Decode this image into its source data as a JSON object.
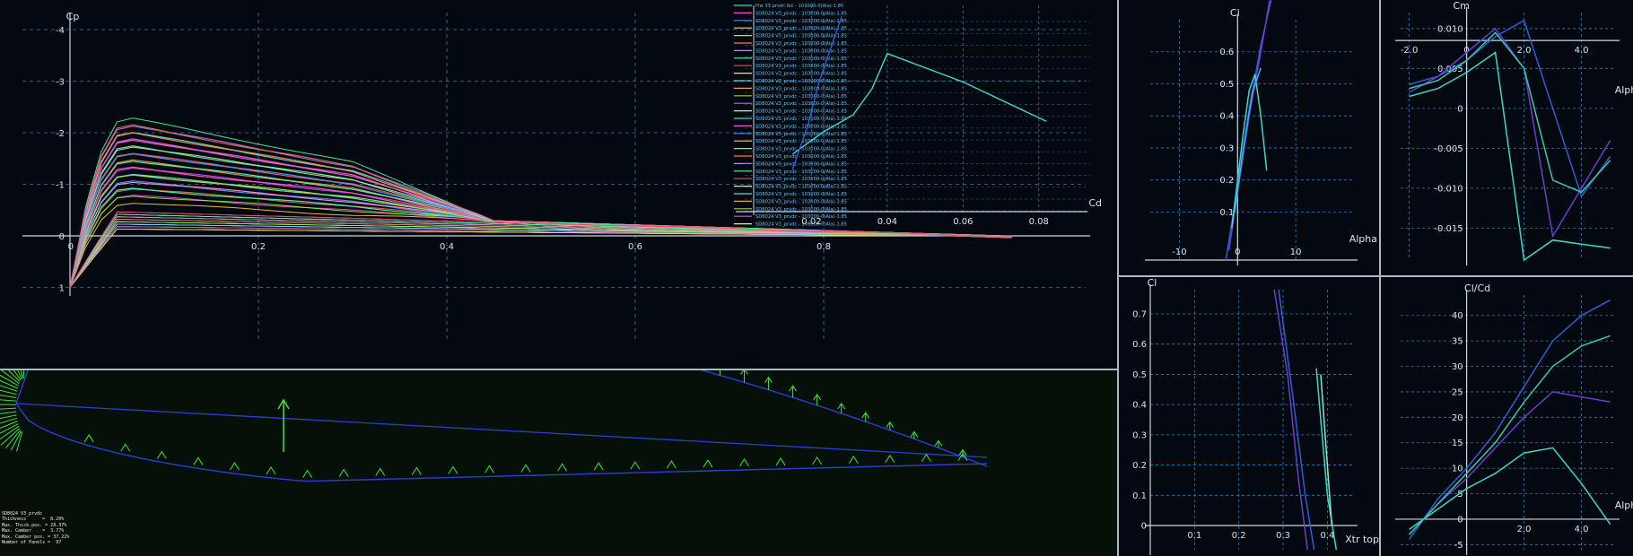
{
  "colors": {
    "axis": "#c9d7e6",
    "grid": "#2f7fb8",
    "text": "#d8e4ee",
    "bg": "#03090f",
    "arrow": "#3ee23e",
    "foil": "#2b3fd8",
    "panel_border": "#aab8c6"
  },
  "cp_graph": {
    "y_label": "Cp",
    "y_ticks": [
      "-4",
      "-3",
      "-2",
      "-1",
      "0",
      "1"
    ],
    "x_ticks": [
      "0.2",
      "0.4",
      "0.6",
      "0.8"
    ],
    "x_origin_label": "0"
  },
  "foil_info": {
    "name": "SD8024 V3_prvdc",
    "lines": [
      "Thickness      =  8.20%",
      "Max. Thick.pos. = 28.37%",
      "Max. Camber    =  3.77%",
      "Max. Camber pos. = 37.22%",
      "Number of Panels =  97"
    ]
  },
  "legend": {
    "first": "Flw 33 prvdc lbc - 103000-0(Ala)-1.85",
    "entry_template": "SD8024 V3_prvdc - 103000-0(Ala)-1.85",
    "count": 30
  },
  "chart_data": [
    {
      "id": "cl-cd",
      "type": "line",
      "xlabel": "Cd",
      "ylabel": "",
      "x_ticks": [
        "0.02",
        "0.04",
        "0.06",
        "0.08"
      ],
      "xlim": [
        0.0,
        0.09
      ],
      "ylim": [
        -0.2,
        0.8
      ],
      "series": [
        {
          "color": "#3fd6c6",
          "x": [
            0.015,
            0.023,
            0.031,
            0.036,
            0.04,
            0.06,
            0.082
          ],
          "y": [
            0.12,
            0.22,
            0.3,
            0.42,
            0.58,
            0.45,
            0.27
          ]
        },
        {
          "color": "#2d5fd8",
          "x": [
            0.015,
            0.019,
            0.022,
            0.025,
            0.028
          ],
          "y": [
            0.05,
            0.25,
            0.45,
            0.6,
            0.75
          ]
        }
      ]
    },
    {
      "id": "cl-alpha",
      "type": "line",
      "xlabel": "Alpha",
      "ylabel": "Cl",
      "x_ticks": [
        "-10",
        "0",
        "10"
      ],
      "y_ticks": [
        "0.1",
        "0.2",
        "0.3",
        "0.4",
        "0.5",
        "0.6"
      ],
      "xlim": [
        -15,
        20
      ],
      "ylim": [
        -0.05,
        0.7
      ],
      "series": [
        {
          "color": "#2d5fd8",
          "x": [
            -2,
            0,
            2,
            4,
            6
          ],
          "y": [
            -0.05,
            0.18,
            0.42,
            0.62,
            0.78
          ]
        },
        {
          "color": "#6a3fd0",
          "x": [
            -1.5,
            0,
            2,
            4,
            5.5
          ],
          "y": [
            -0.02,
            0.16,
            0.4,
            0.6,
            0.76
          ]
        },
        {
          "color": "#3fd6c6",
          "x": [
            -1,
            0,
            1,
            2,
            3,
            4,
            5
          ],
          "y": [
            0.05,
            0.2,
            0.35,
            0.48,
            0.53,
            0.4,
            0.23
          ]
        },
        {
          "color": "#32b4f0",
          "x": [
            -0.5,
            1,
            2.5,
            4
          ],
          "y": [
            0.1,
            0.3,
            0.47,
            0.55
          ]
        }
      ]
    },
    {
      "id": "cm-alpha",
      "type": "line",
      "xlabel": "Alpha",
      "ylabel": "Cm",
      "x_ticks": [
        "-2.0",
        "0",
        "2.0",
        "4.0"
      ],
      "y_ticks": [
        "0.010",
        "0.005",
        "0",
        "-0.005",
        "-0.010",
        "-0.015"
      ],
      "xlim": [
        -2.3,
        5.2
      ],
      "ylim": [
        -0.019,
        0.012
      ],
      "series": [
        {
          "color": "#2d5fd8",
          "x": [
            -2,
            -1,
            0,
            1,
            2,
            3,
            4,
            5
          ],
          "y": [
            0.003,
            0.004,
            0.006,
            0.009,
            0.011,
            0.0,
            -0.011,
            -0.006
          ]
        },
        {
          "color": "#6a3fd0",
          "x": [
            -2,
            -1,
            0,
            1,
            2,
            3,
            4,
            5
          ],
          "y": [
            0.002,
            0.004,
            0.007,
            0.01,
            0.005,
            -0.016,
            -0.01,
            -0.004
          ]
        },
        {
          "color": "#3fd6c6",
          "x": [
            -2,
            -1,
            0,
            1,
            2,
            3,
            4,
            5
          ],
          "y": [
            0.0015,
            0.0025,
            0.0045,
            0.007,
            -0.019,
            -0.0165,
            -0.017,
            -0.0175
          ]
        },
        {
          "color": "#39c9a8",
          "x": [
            -2,
            -1,
            0,
            1,
            2,
            3,
            4,
            5
          ],
          "y": [
            0.0025,
            0.0035,
            0.006,
            0.0095,
            0.005,
            -0.009,
            -0.0105,
            -0.0065
          ]
        }
      ]
    },
    {
      "id": "cl-xtr",
      "type": "line",
      "xlabel": "Xtr top",
      "ylabel": "Cl",
      "x_ticks": [
        "0.1",
        "0.2",
        "0.3",
        "0.4"
      ],
      "y_ticks": [
        "0",
        "0.1",
        "0.2",
        "0.3",
        "0.4",
        "0.5",
        "0.6",
        "0.7"
      ],
      "xlim": [
        0.0,
        0.46
      ],
      "ylim": [
        -0.08,
        0.78
      ],
      "series": [
        {
          "color": "#2d5fd8",
          "x": [
            0.29,
            0.32,
            0.35,
            0.37
          ],
          "y": [
            0.78,
            0.45,
            0.1,
            -0.08
          ]
        },
        {
          "color": "#6a3fd0",
          "x": [
            0.28,
            0.31,
            0.335,
            0.355
          ],
          "y": [
            0.78,
            0.5,
            0.15,
            -0.08
          ]
        },
        {
          "color": "#3fd6c6",
          "x": [
            0.375,
            0.385,
            0.4,
            0.42
          ],
          "y": [
            0.52,
            0.35,
            0.1,
            -0.08
          ]
        },
        {
          "color": "#7fe8dc",
          "x": [
            0.385,
            0.395,
            0.41
          ],
          "y": [
            0.5,
            0.3,
            0.0
          ]
        }
      ]
    },
    {
      "id": "cl-cd-alpha",
      "type": "line",
      "xlabel": "Alpha",
      "ylabel": "Cl/Cd",
      "x_ticks": [
        "2.0",
        "4.0"
      ],
      "y_ticks": [
        "-5",
        "0",
        "5",
        "10",
        "15",
        "20",
        "25",
        "30",
        "35",
        "40"
      ],
      "xlim": [
        -2.3,
        5.2
      ],
      "ylim": [
        -6,
        44
      ],
      "series": [
        {
          "color": "#2d5fd8",
          "x": [
            -2,
            -1,
            0,
            1,
            2,
            3,
            4,
            5
          ],
          "y": [
            -4,
            4,
            10,
            17,
            26,
            35,
            40,
            43
          ]
        },
        {
          "color": "#6a3fd0",
          "x": [
            -2,
            -1,
            0,
            1,
            2,
            3,
            4,
            5
          ],
          "y": [
            -3,
            3,
            8,
            14,
            20,
            25,
            24,
            23
          ]
        },
        {
          "color": "#3fd6c6",
          "x": [
            -2,
            -1,
            0,
            1,
            2,
            3,
            4,
            5
          ],
          "y": [
            -2,
            2,
            6,
            9,
            13,
            14,
            7,
            -1
          ]
        },
        {
          "color": "#39c9a8",
          "x": [
            -2,
            -1,
            0,
            1,
            2,
            3,
            4,
            5
          ],
          "y": [
            -3,
            3,
            9,
            15,
            23,
            30,
            34,
            36
          ]
        }
      ]
    }
  ]
}
